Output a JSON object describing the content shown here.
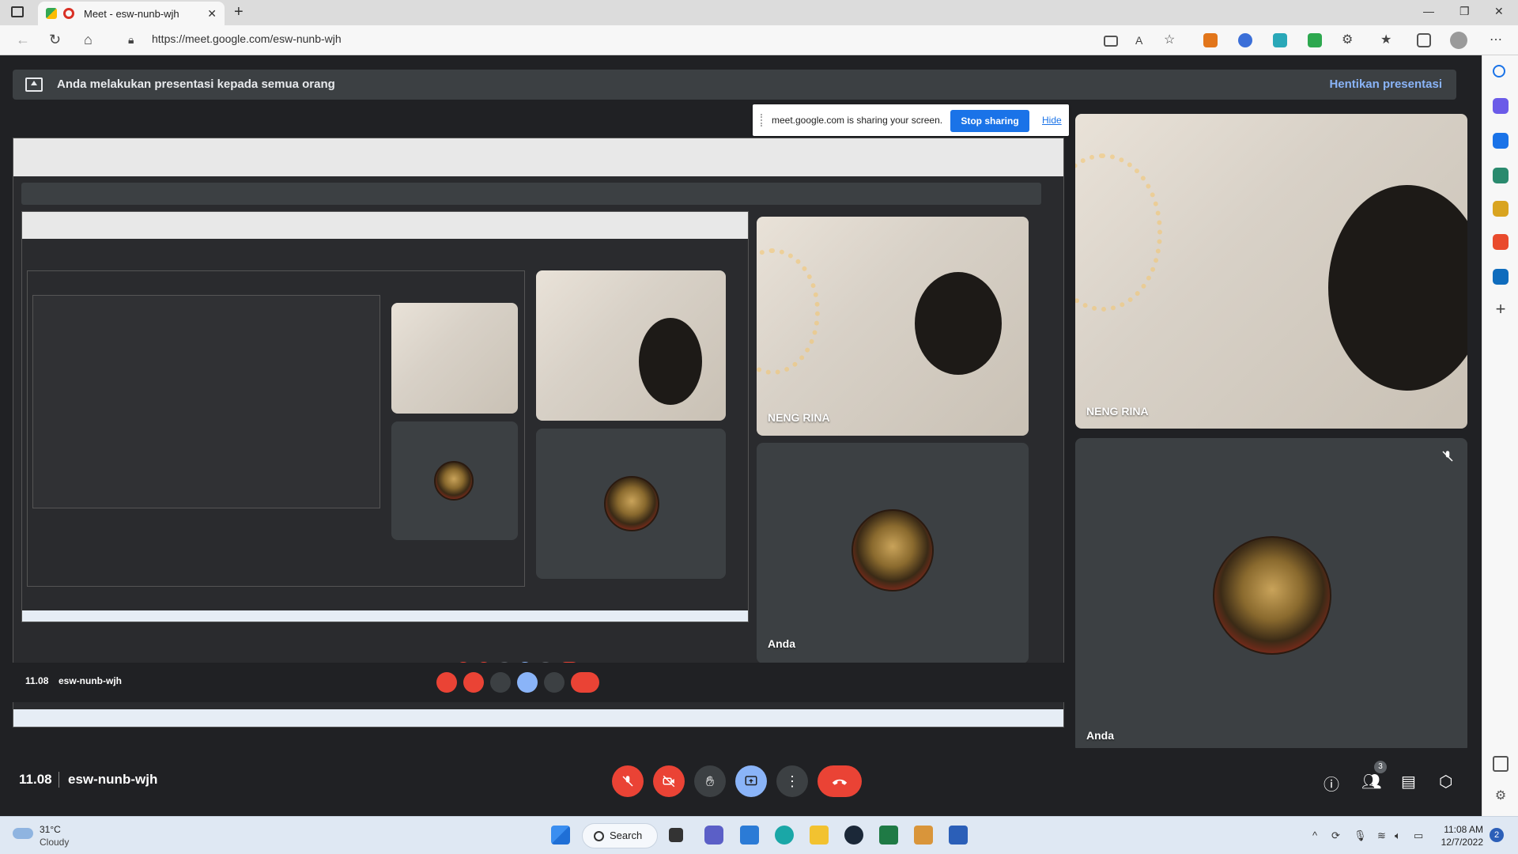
{
  "browser": {
    "tab_title": "Meet - esw-nunb-wjh",
    "url": "https://meet.google.com/esw-nunb-wjh"
  },
  "meet": {
    "banner_text": "Anda melakukan presentasi kepada semua orang",
    "stop_presenting": "Hentikan presentasi",
    "share_message": "meet.google.com is sharing your screen.",
    "stop_sharing": "Stop sharing",
    "hide": "Hide",
    "time": "11.08",
    "meeting_code": "esw-nunb-wjh",
    "participant_count": "3",
    "participants": [
      {
        "name": "NENG RINA"
      },
      {
        "name": "Anda"
      }
    ]
  },
  "taskbar": {
    "weather_temp": "31°C",
    "weather_desc": "Cloudy",
    "search": "Search",
    "time": "11:08 AM",
    "date": "12/7/2022",
    "notifications": "2"
  },
  "colors": {
    "meet_bg": "#202124",
    "accent_blue": "#8ab4f8",
    "end_call_red": "#ea4335",
    "share_button": "#1a73e8"
  }
}
